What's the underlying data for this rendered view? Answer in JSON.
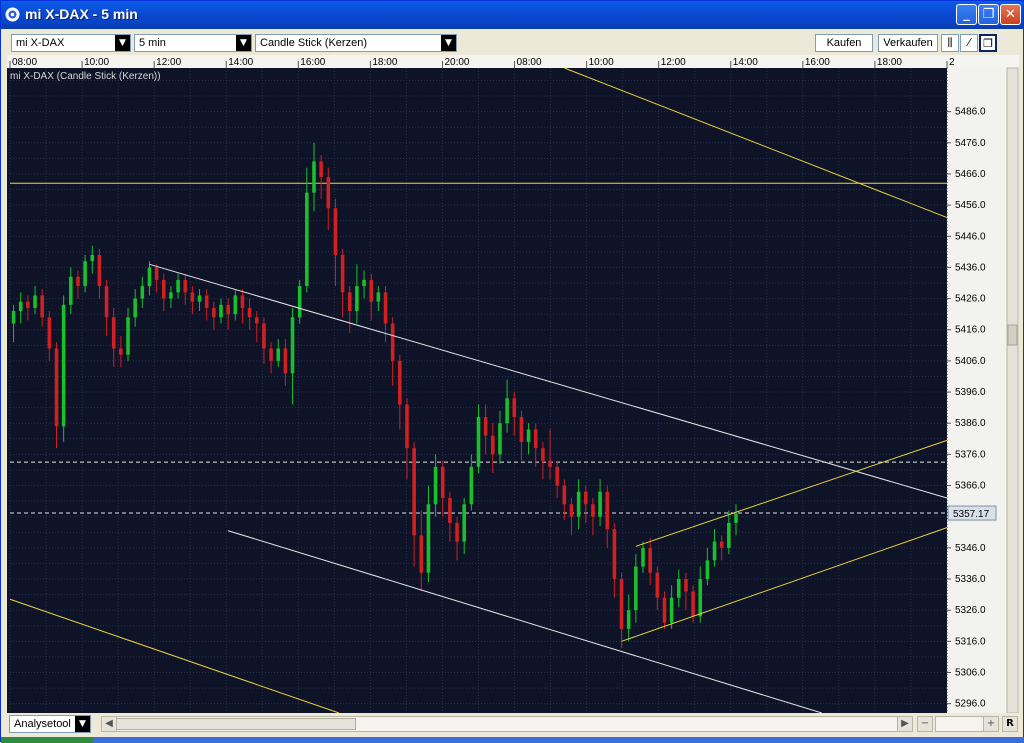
{
  "window": {
    "title": "mi X-DAX - 5 min"
  },
  "toolbar": {
    "instrument": "mi X-DAX",
    "interval": "5 min",
    "chart_type": "Candle Stick (Kerzen)",
    "buy_label": "Kaufen",
    "sell_label": "Verkaufen"
  },
  "chart": {
    "label": "mi X-DAX (Candle Stick (Kerzen))",
    "time_ticks": [
      "08:00",
      "10:00",
      "12:00",
      "14:00",
      "16:00",
      "18:00",
      "20:00",
      "08:00",
      "10:00",
      "12:00",
      "14:00",
      "16:00",
      "18:00",
      "2"
    ],
    "price_ticks": [
      "5486.0",
      "5476.0",
      "5466.0",
      "5456.0",
      "5446.0",
      "5436.0",
      "5426.0",
      "5416.0",
      "5406.0",
      "5396.0",
      "5386.0",
      "5376.0",
      "5366.0",
      "5346.0",
      "5336.0",
      "5326.0",
      "5316.0",
      "5306.0",
      "5296.0"
    ],
    "current_price": "5357.17",
    "colors": {
      "bg": "#0e1328",
      "grid": "#27304d",
      "up": "#19c02a",
      "down": "#d02020",
      "yellow": "#e8d43a",
      "white": "#e6e6e6"
    }
  },
  "bottom": {
    "analysis_tool": "Analysetool",
    "r_label": "R"
  },
  "chart_data": {
    "type": "candlestick",
    "ylim": [
      5293,
      5500
    ],
    "x_range": [
      0,
      131
    ],
    "horizontal_lines": [
      {
        "price": 5463.0,
        "style": "solid",
        "color": "yellow"
      },
      {
        "price": 5373.5,
        "style": "dashed",
        "color": "white"
      },
      {
        "price": 5357.17,
        "style": "dashed",
        "color": "white"
      }
    ],
    "trend_lines": [
      {
        "color": "white",
        "points": [
          [
            19.5,
            5437.0
          ],
          [
            131,
            5362.0
          ]
        ]
      },
      {
        "color": "white",
        "points": [
          [
            30.5,
            5351.5
          ],
          [
            113.5,
            5293.0
          ]
        ]
      },
      {
        "color": "yellow",
        "points": [
          [
            77.5,
            5500.0
          ],
          [
            131,
            5452.0
          ]
        ]
      },
      {
        "color": "yellow",
        "points": [
          [
            0,
            5329.5
          ],
          [
            46,
            5293.0
          ]
        ]
      },
      {
        "color": "yellow",
        "points": [
          [
            85.5,
            5316.0
          ],
          [
            131,
            5352.5
          ]
        ]
      },
      {
        "color": "yellow",
        "points": [
          [
            87.5,
            5346.5
          ],
          [
            131,
            5380.5
          ]
        ]
      }
    ],
    "candles": [
      [
        5418,
        5422,
        5412,
        5424
      ],
      [
        5422,
        5425,
        5418,
        5428
      ],
      [
        5425,
        5423,
        5419,
        5427
      ],
      [
        5423,
        5427,
        5421,
        5430
      ],
      [
        5427,
        5420,
        5417,
        5429
      ],
      [
        5420,
        5410,
        5406,
        5422
      ],
      [
        5410,
        5385,
        5378,
        5412
      ],
      [
        5385,
        5424,
        5380,
        5427
      ],
      [
        5424,
        5433,
        5421,
        5436
      ],
      [
        5433,
        5430,
        5426,
        5435
      ],
      [
        5430,
        5438,
        5428,
        5440
      ],
      [
        5438,
        5440,
        5434,
        5443
      ],
      [
        5440,
        5430,
        5426,
        5442
      ],
      [
        5430,
        5420,
        5414,
        5432
      ],
      [
        5420,
        5410,
        5404,
        5423
      ],
      [
        5410,
        5408,
        5404,
        5414
      ],
      [
        5408,
        5420,
        5406,
        5423
      ],
      [
        5420,
        5426,
        5417,
        5429
      ],
      [
        5426,
        5430,
        5423,
        5433
      ],
      [
        5430,
        5436,
        5427,
        5438
      ],
      [
        5436,
        5432,
        5428,
        5437
      ],
      [
        5432,
        5426,
        5422,
        5434
      ],
      [
        5426,
        5428,
        5423,
        5430
      ],
      [
        5428,
        5432,
        5426,
        5434
      ],
      [
        5432,
        5428,
        5424,
        5434
      ],
      [
        5428,
        5425,
        5421,
        5430
      ],
      [
        5425,
        5427,
        5422,
        5429
      ],
      [
        5427,
        5423,
        5419,
        5429
      ],
      [
        5423,
        5420,
        5416,
        5425
      ],
      [
        5420,
        5424,
        5418,
        5426
      ],
      [
        5424,
        5421,
        5416,
        5426
      ],
      [
        5421,
        5427,
        5419,
        5429
      ],
      [
        5427,
        5423,
        5418,
        5429
      ],
      [
        5423,
        5420,
        5416,
        5426
      ],
      [
        5420,
        5418,
        5412,
        5422
      ],
      [
        5418,
        5410,
        5405,
        5420
      ],
      [
        5410,
        5406,
        5402,
        5412
      ],
      [
        5406,
        5410,
        5404,
        5413
      ],
      [
        5410,
        5402,
        5398,
        5413
      ],
      [
        5402,
        5420,
        5392,
        5423
      ],
      [
        5420,
        5430,
        5418,
        5432
      ],
      [
        5430,
        5460,
        5428,
        5468
      ],
      [
        5460,
        5470,
        5454,
        5476
      ],
      [
        5470,
        5465,
        5458,
        5472
      ],
      [
        5465,
        5455,
        5448,
        5468
      ],
      [
        5455,
        5440,
        5430,
        5458
      ],
      [
        5440,
        5428,
        5420,
        5442
      ],
      [
        5428,
        5422,
        5415,
        5430
      ],
      [
        5422,
        5430,
        5418,
        5437
      ],
      [
        5430,
        5432,
        5426,
        5435
      ],
      [
        5432,
        5425,
        5419,
        5434
      ],
      [
        5425,
        5428,
        5422,
        5430
      ],
      [
        5428,
        5418,
        5412,
        5430
      ],
      [
        5418,
        5406,
        5398,
        5420
      ],
      [
        5406,
        5392,
        5384,
        5408
      ],
      [
        5392,
        5378,
        5368,
        5394
      ],
      [
        5378,
        5350,
        5340,
        5380
      ],
      [
        5350,
        5338,
        5332,
        5358
      ],
      [
        5338,
        5360,
        5335,
        5366
      ],
      [
        5360,
        5372,
        5356,
        5376
      ],
      [
        5372,
        5362,
        5356,
        5374
      ],
      [
        5362,
        5354,
        5348,
        5364
      ],
      [
        5354,
        5348,
        5342,
        5356
      ],
      [
        5348,
        5360,
        5344,
        5362
      ],
      [
        5360,
        5372,
        5358,
        5376
      ],
      [
        5372,
        5388,
        5370,
        5392
      ],
      [
        5388,
        5382,
        5376,
        5392
      ],
      [
        5382,
        5376,
        5370,
        5386
      ],
      [
        5376,
        5386,
        5373,
        5390
      ],
      [
        5386,
        5394,
        5383,
        5400
      ],
      [
        5394,
        5388,
        5382,
        5396
      ],
      [
        5388,
        5380,
        5374,
        5390
      ],
      [
        5380,
        5384,
        5376,
        5386
      ],
      [
        5384,
        5378,
        5372,
        5386
      ],
      [
        5378,
        5374,
        5368,
        5380
      ],
      [
        5374,
        5372,
        5368,
        5384
      ],
      [
        5372,
        5366,
        5362,
        5374
      ],
      [
        5366,
        5360,
        5355,
        5368
      ],
      [
        5360,
        5356,
        5350,
        5362
      ],
      [
        5356,
        5364,
        5352,
        5368
      ],
      [
        5364,
        5360,
        5354,
        5366
      ],
      [
        5360,
        5356,
        5350,
        5362
      ],
      [
        5356,
        5364,
        5353,
        5368
      ],
      [
        5364,
        5352,
        5346,
        5366
      ],
      [
        5352,
        5336,
        5330,
        5354
      ],
      [
        5336,
        5320,
        5314,
        5338
      ],
      [
        5320,
        5326,
        5316,
        5331
      ],
      [
        5326,
        5340,
        5322,
        5344
      ],
      [
        5340,
        5346,
        5338,
        5348
      ],
      [
        5346,
        5338,
        5334,
        5349
      ],
      [
        5338,
        5330,
        5326,
        5340
      ],
      [
        5330,
        5322,
        5320,
        5332
      ],
      [
        5322,
        5330,
        5320,
        5334
      ],
      [
        5330,
        5336,
        5327,
        5339
      ],
      [
        5336,
        5332,
        5326,
        5338
      ],
      [
        5332,
        5324,
        5322,
        5334
      ],
      [
        5324,
        5336,
        5322,
        5340
      ],
      [
        5336,
        5342,
        5334,
        5346
      ],
      [
        5342,
        5348,
        5340,
        5352
      ],
      [
        5348,
        5346,
        5342,
        5350
      ],
      [
        5346,
        5354,
        5344,
        5358
      ],
      [
        5354,
        5357,
        5350,
        5360
      ]
    ]
  }
}
